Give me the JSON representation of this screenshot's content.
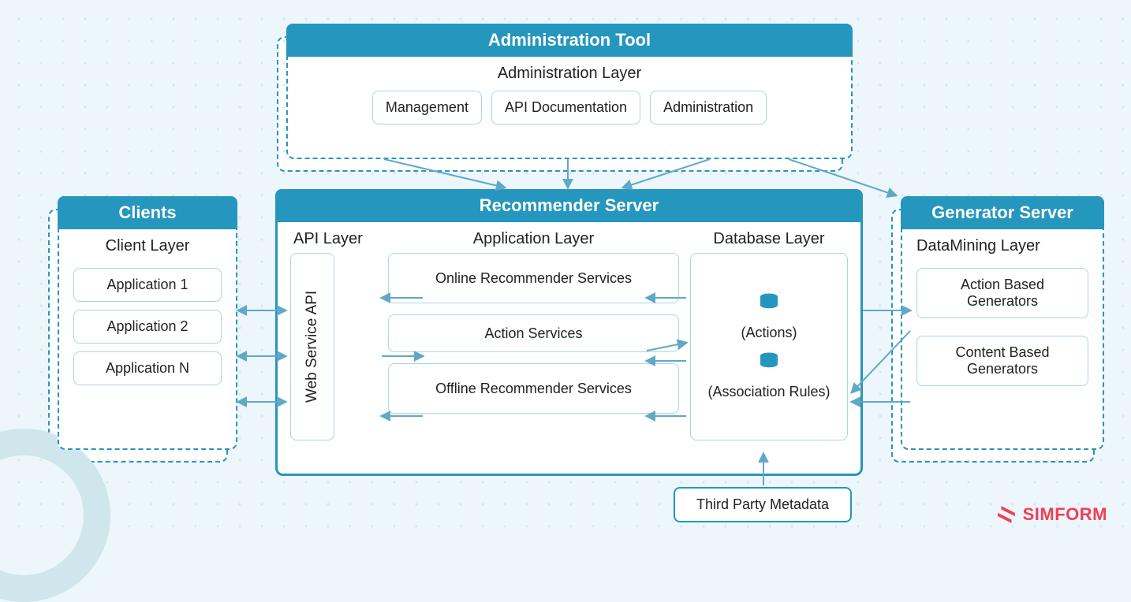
{
  "admin": {
    "title": "Administration Tool",
    "layer": "Administration Layer",
    "items": [
      "Management",
      "API Documentation",
      "Administration"
    ]
  },
  "clients": {
    "title": "Clients",
    "layer": "Client Layer",
    "items": [
      "Application 1",
      "Application 2",
      "Application N"
    ]
  },
  "rec": {
    "title": "Recommender Server",
    "api_layer": "API Layer",
    "app_layer": "Application Layer",
    "db_layer": "Database Layer",
    "web_api": "Web Service API",
    "app_items": [
      "Online Recommender Services",
      "Action Services",
      "Offline Recommender Services"
    ],
    "db_items": [
      "(Actions)",
      "(Association Rules)"
    ]
  },
  "gen": {
    "title": "Generator Server",
    "layer": "DataMining Layer",
    "items": [
      "Action Based Generators",
      "Content Based Generators"
    ]
  },
  "extra": {
    "third_party": "Third Party Metadata"
  },
  "brand": {
    "name": "SIMFORM"
  },
  "colors": {
    "accent": "#2596be",
    "brand": "#ef4056",
    "bg": "#edf6fa"
  }
}
